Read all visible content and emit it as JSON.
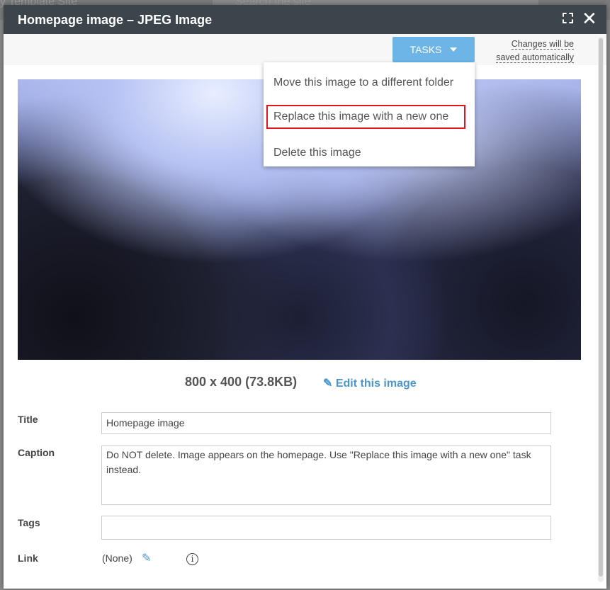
{
  "background": {
    "site_name": "y Template Site",
    "search_placeholder": "Search the site"
  },
  "dialog": {
    "title": "Homepage image – JPEG Image",
    "maximize_icon": "expand-icon",
    "close_icon": "close-icon"
  },
  "toolbar": {
    "tasks_label": "TASKS",
    "save_note_line1": "Changes will be",
    "save_note_line2": "saved automatically"
  },
  "tasks_menu": {
    "items": [
      "Move this image to a different folder",
      "Replace this image with a new one",
      "Delete this image"
    ],
    "highlighted": 1,
    "highlight_color": "#e0141e"
  },
  "image_info": {
    "dimensions": "800 x 400 (73.8KB)",
    "edit_label": "Edit this image"
  },
  "form": {
    "title_label": "Title",
    "title_value": "Homepage image",
    "caption_label": "Caption",
    "caption_value": "Do NOT delete. Image appears on the homepage. Use \"Replace this image with a new one\" task instead.",
    "tags_label": "Tags",
    "tags_value": "",
    "link_label": "Link",
    "link_value": "(None)"
  },
  "colors": {
    "header": "#3d454c",
    "accent": "#6cb5e6",
    "link": "#4a97cf"
  }
}
